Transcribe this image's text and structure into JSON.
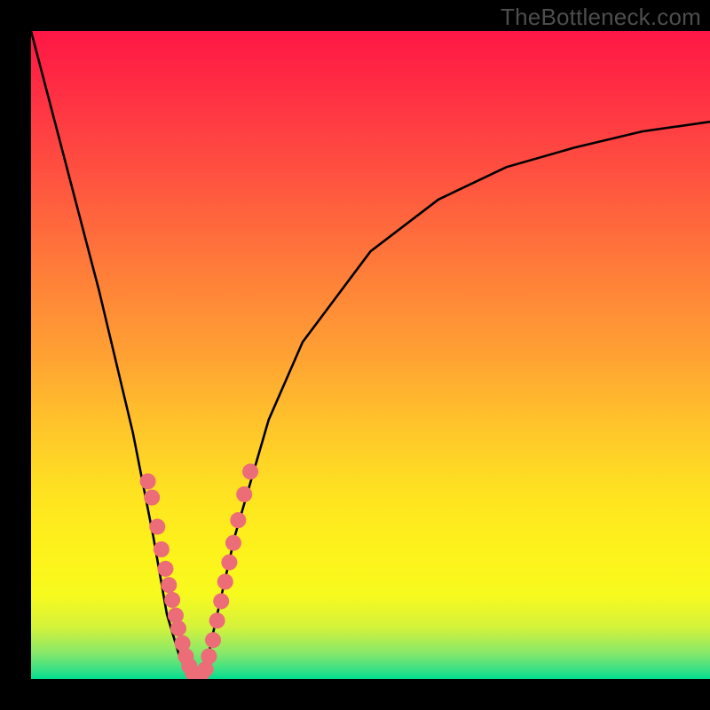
{
  "watermark": "TheBottleneck.com",
  "chart_data": {
    "type": "line",
    "title": "",
    "xlabel": "",
    "ylabel": "",
    "xlim": [
      0,
      100
    ],
    "ylim": [
      0,
      100
    ],
    "grid": false,
    "legend": false,
    "series": [
      {
        "name": "bottleneck-curve",
        "x": [
          0,
          5,
          10,
          15,
          18,
          20,
          22,
          24,
          26,
          27,
          30,
          35,
          40,
          50,
          60,
          70,
          80,
          90,
          100
        ],
        "y": [
          100,
          80,
          60,
          38,
          22,
          10,
          3,
          0,
          3,
          8,
          22,
          40,
          52,
          66,
          74,
          79,
          82,
          84.5,
          86
        ],
        "color": "#000000"
      }
    ],
    "markers": [
      {
        "name": "left-cluster-dots",
        "color": "#ec6c77",
        "points": [
          {
            "x": 17.2,
            "y": 30.5
          },
          {
            "x": 17.8,
            "y": 28.0
          },
          {
            "x": 18.6,
            "y": 23.5
          },
          {
            "x": 19.2,
            "y": 20.0
          },
          {
            "x": 19.8,
            "y": 17.0
          },
          {
            "x": 20.3,
            "y": 14.5
          },
          {
            "x": 20.8,
            "y": 12.2
          },
          {
            "x": 21.3,
            "y": 9.8
          },
          {
            "x": 21.7,
            "y": 7.8
          },
          {
            "x": 22.3,
            "y": 5.5
          },
          {
            "x": 22.8,
            "y": 3.5
          },
          {
            "x": 23.3,
            "y": 2.0
          },
          {
            "x": 23.8,
            "y": 1.0
          },
          {
            "x": 24.3,
            "y": 0.5
          },
          {
            "x": 25.0,
            "y": 0.5
          }
        ]
      },
      {
        "name": "right-cluster-dots",
        "color": "#ec6c77",
        "points": [
          {
            "x": 25.7,
            "y": 1.5
          },
          {
            "x": 26.2,
            "y": 3.5
          },
          {
            "x": 26.8,
            "y": 6.0
          },
          {
            "x": 27.4,
            "y": 9.0
          },
          {
            "x": 28.0,
            "y": 12.0
          },
          {
            "x": 28.6,
            "y": 15.0
          },
          {
            "x": 29.2,
            "y": 18.0
          },
          {
            "x": 29.8,
            "y": 21.0
          },
          {
            "x": 30.5,
            "y": 24.5
          },
          {
            "x": 31.4,
            "y": 28.5
          },
          {
            "x": 32.3,
            "y": 32.0
          }
        ]
      }
    ],
    "gradient_colors": {
      "top": "#ff1745",
      "mid_upper": "#ff7a3a",
      "mid": "#ffc82a",
      "mid_lower": "#fdf21b",
      "bottom": "#00dd8f"
    }
  }
}
